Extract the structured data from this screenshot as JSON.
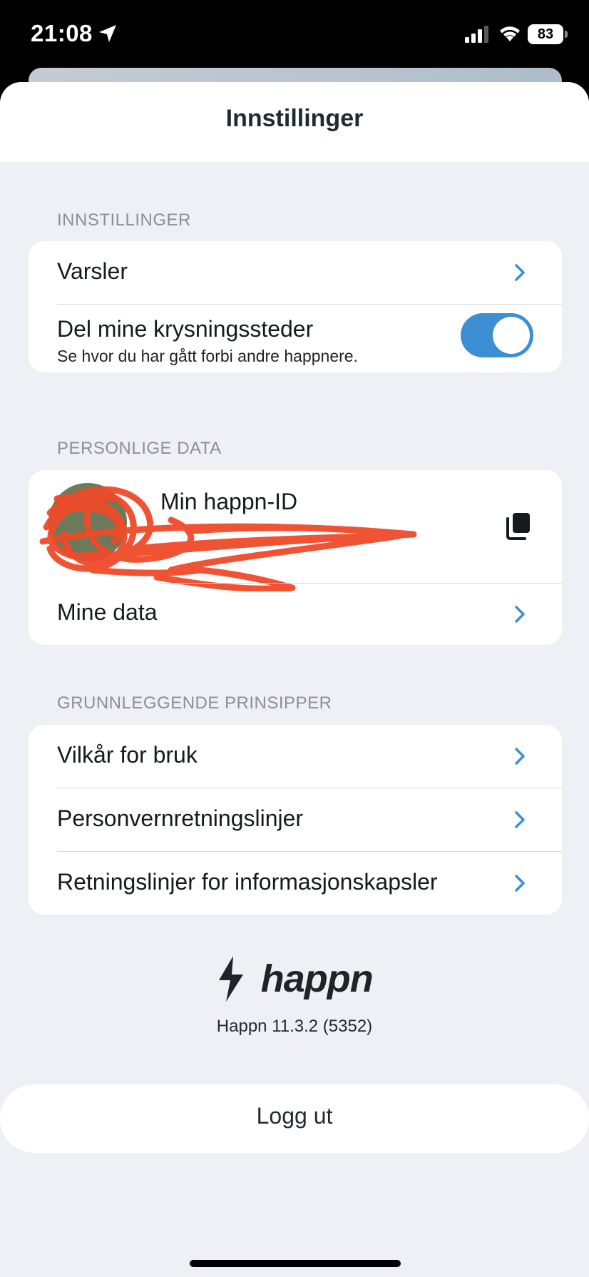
{
  "status_bar": {
    "time": "21:08",
    "battery": "83"
  },
  "header": {
    "title": "Innstillinger"
  },
  "sections": {
    "settings": {
      "label": "INNSTILLINGER",
      "notifications": "Varsler",
      "crossings_title": "Del mine krysningssteder",
      "crossings_subtitle": "Se hvor du har gått forbi andre happnere.",
      "crossings_enabled": true
    },
    "personal": {
      "label": "PERSONLIGE DATA",
      "id_title": "Min happn-ID",
      "id_value": "",
      "my_data": "Mine data"
    },
    "principles": {
      "label": "GRUNNLEGGENDE PRINSIPPER",
      "terms": "Vilkår for bruk",
      "privacy": "Personvernretningslinjer",
      "cookies": "Retningslinjer for informasjonskapsler"
    }
  },
  "footer": {
    "brand": "happn",
    "version": "Happn 11.3.2 (5352)",
    "logout": "Logg ut"
  },
  "colors": {
    "accent": "#3b8fd2",
    "background": "#eff0f5",
    "redaction": "#f04a2a"
  }
}
